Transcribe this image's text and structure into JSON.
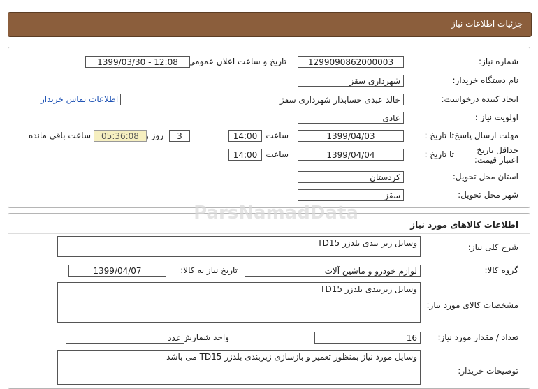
{
  "header": {
    "title": "جزئیات اطلاعات نیاز"
  },
  "info": {
    "need_number_label": "شماره نیاز:",
    "need_number": "1299090862000003",
    "announce_label": "تاریخ و ساعت اعلان عمومی:",
    "announce_value": "1399/03/30 - 12:08",
    "buyer_org_label": "نام دستگاه خریدار:",
    "buyer_org": "شهرداری سقز",
    "requester_label": "ایجاد کننده درخواست:",
    "requester": "خالد عبدی حسابدار شهرداری سقز",
    "contact_link": "اطلاعات تماس خریدار",
    "priority_label": "اولویت نیاز :",
    "priority": "عادی",
    "deadline_label": "مهلت ارسال پاسخ:",
    "to_date_label": "تا تاریخ :",
    "deadline_date": "1399/04/03",
    "time_label": "ساعت",
    "deadline_time": "14:00",
    "days_value": "3",
    "days_label": "روز و",
    "remaining_time": "05:36:08",
    "remaining_label": "ساعت باقی مانده",
    "validity_label": "حداقل تاریخ اعتبار قیمت:",
    "validity_date": "1399/04/04",
    "validity_time": "14:00",
    "province_label": "استان محل تحویل:",
    "province": "کردستان",
    "city_label": "شهر محل تحویل:",
    "city": "سقز"
  },
  "goods": {
    "section_title": "اطلاعات کالاهای مورد نیاز",
    "general_desc_label": "شرح کلی نیاز:",
    "general_desc": "وسایل زیر بندی بلدزر TD15",
    "group_label": "گروه کالا:",
    "group": "لوازم خودرو و ماشین آلات",
    "need_date_label": "تاریخ نیاز به کالا:",
    "need_date": "1399/04/07",
    "spec_label": "مشخصات کالای مورد نیاز:",
    "spec": "وسایل زیربندی بلدزر TD15",
    "qty_label": "تعداد / مقدار مورد نیاز:",
    "qty": "16",
    "unit_label": "واحد شمارش:",
    "unit": "عدد",
    "buyer_notes_label": "توضیحات خریدار:",
    "buyer_notes": "وسایل مورد نیاز بمنظور تعمیر و بازسازی زیربندی بلدزر  TD15 می باشد"
  },
  "watermark": {
    "text": "ParsNamadData"
  }
}
